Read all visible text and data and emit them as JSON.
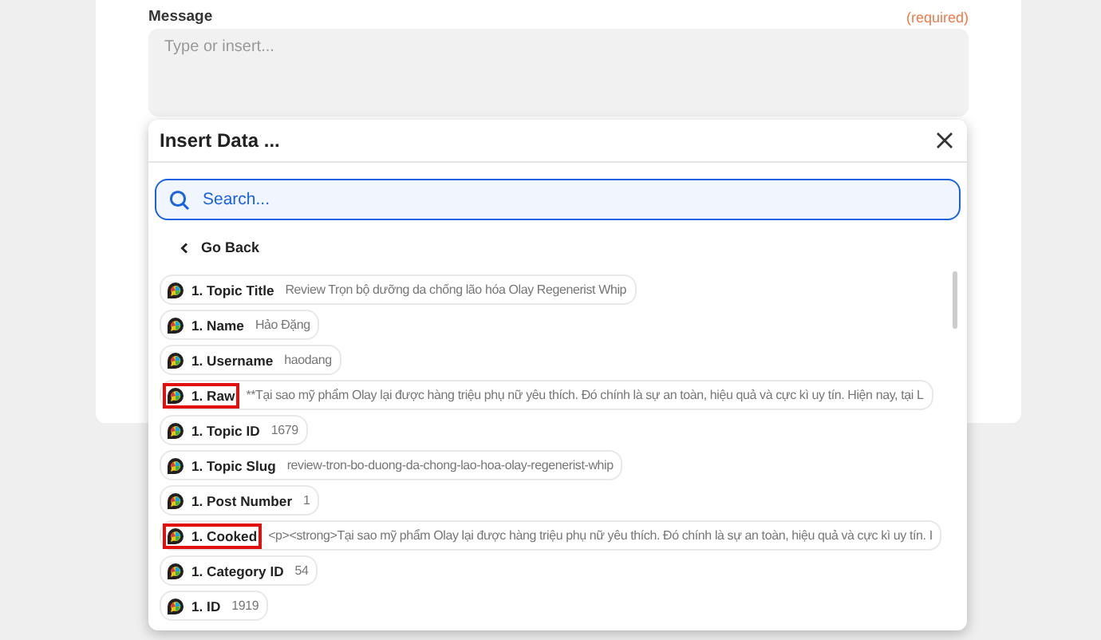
{
  "field": {
    "label": "Message",
    "required": "(required)",
    "placeholder": "Type or insert..."
  },
  "popup": {
    "title": "Insert Data ...",
    "search": {
      "placeholder": "Search..."
    },
    "back": "Go Back",
    "rows": [
      {
        "label": "1. Topic Title",
        "value": "Review Trọn bộ dưỡng da chống lão hóa Olay Regenerist Whip",
        "highlighted": false
      },
      {
        "label": "1. Name",
        "value": "Hảo Đặng",
        "highlighted": false
      },
      {
        "label": "1. Username",
        "value": "haodang",
        "highlighted": false
      },
      {
        "label": "1. Raw",
        "value": "**Tại sao mỹ phẩm Olay lại được hàng triệu phụ nữ yêu thích. Đó chính là sự an toàn, hiệu quả và cực kì uy tín. Hiện nay, tại L",
        "highlighted": true
      },
      {
        "label": "1. Topic ID",
        "value": "1679",
        "highlighted": false
      },
      {
        "label": "1. Topic Slug",
        "value": "review-tron-bo-duong-da-chong-lao-hoa-olay-regenerist-whip",
        "highlighted": false
      },
      {
        "label": "1. Post Number",
        "value": "1",
        "highlighted": false
      },
      {
        "label": "1. Cooked",
        "value": "<p><strong>Tại sao mỹ phẩm Olay lại được hàng triệu phụ nữ yêu thích. Đó chính là sự an toàn, hiệu quả và cực kì uy tín. I",
        "highlighted": true
      },
      {
        "label": "1. Category ID",
        "value": "54",
        "highlighted": false
      },
      {
        "label": "1. ID",
        "value": "1919",
        "highlighted": false
      }
    ]
  }
}
